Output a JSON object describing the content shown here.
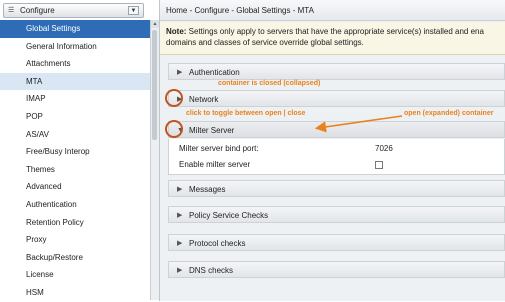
{
  "toolbar": {
    "configure_label": "Configure"
  },
  "sidebar": {
    "items": [
      {
        "label": "Global Settings"
      },
      {
        "label": "General Information"
      },
      {
        "label": "Attachments"
      },
      {
        "label": "MTA"
      },
      {
        "label": "IMAP"
      },
      {
        "label": "POP"
      },
      {
        "label": "AS/AV"
      },
      {
        "label": "Free/Busy Interop"
      },
      {
        "label": "Themes"
      },
      {
        "label": "Advanced"
      },
      {
        "label": "Authentication"
      },
      {
        "label": "Retention Policy"
      },
      {
        "label": "Proxy"
      },
      {
        "label": "Backup/Restore"
      },
      {
        "label": "License"
      },
      {
        "label": "HSM"
      }
    ]
  },
  "header": {
    "breadcrumb": "Home - Configure - Global Settings - MTA"
  },
  "note": {
    "label": "Note:",
    "line1": " Settings only apply to servers that have the appropriate service(s) installed and ena",
    "line2": "domains and classes of service override global settings."
  },
  "sections": {
    "authentication": "Authentication",
    "network": "Network",
    "milter": "Milter Server",
    "messages": "Messages",
    "policy": "Policy Service Checks",
    "protocol": "Protocol checks",
    "dns": "DNS checks"
  },
  "milter": {
    "bind_port_label": "Milter server bind port:",
    "bind_port_value": "7026",
    "enable_label": "Enable milter server"
  },
  "annotations": {
    "closed": "container is closed (collapsed)",
    "toggle": "click to toggle between open | close",
    "open": "open (expanded) container"
  },
  "colors": {
    "selected": "#2e6db5",
    "annotation": "#e8821e",
    "circle": "#c0561f"
  }
}
